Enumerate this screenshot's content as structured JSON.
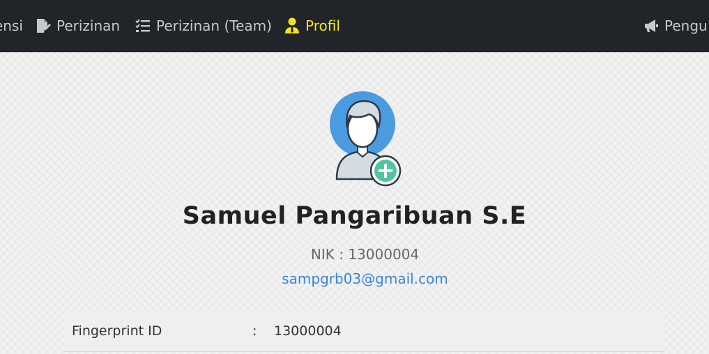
{
  "nav": {
    "items": [
      {
        "label": "ensi",
        "icon": "calendar-icon"
      },
      {
        "label": "Perizinan",
        "icon": "file-signature-icon"
      },
      {
        "label": "Perizinan (Team)",
        "icon": "tasks-icon"
      },
      {
        "label": "Profil",
        "icon": "user-tie-icon",
        "active": true
      },
      {
        "label": "Pengu",
        "icon": "bullhorn-icon"
      }
    ]
  },
  "profile": {
    "name": "Samuel Pangaribuan S.E",
    "nik_label": "NIK",
    "nik_separator": ":",
    "nik_value": "13000004",
    "email": "sampgrb03@gmail.com"
  },
  "details": {
    "rows": [
      {
        "label": "Fingerprint ID",
        "separator": ":",
        "value": "13000004"
      }
    ]
  },
  "colors": {
    "navbar_bg": "#212529",
    "nav_text": "#c9c9c9",
    "nav_active": "#f5e21c",
    "link": "#3a86d6"
  }
}
